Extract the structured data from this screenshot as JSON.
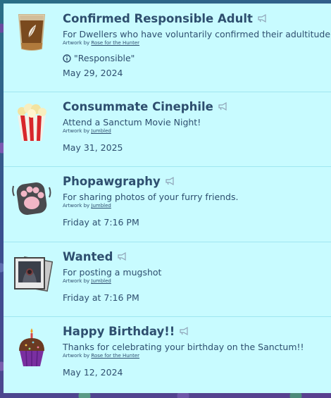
{
  "achievements": [
    {
      "title": "Confirmed Responsible Adult",
      "description": "For Dwellers who have voluntarily confirmed their adultitude",
      "artwork_prefix": "Artwork by",
      "artist": "Rose for the Hunter",
      "note": "\"Responsible\"",
      "date": "May 29, 2024",
      "icon": "drink-glass-icon"
    },
    {
      "title": "Consummate Cinephile",
      "description": "Attend a Sanctum Movie Night!",
      "artwork_prefix": "Artwork by",
      "artist": "Jumbled",
      "date": "May 31, 2025",
      "icon": "popcorn-icon"
    },
    {
      "title": "Phopawgraphy",
      "description": "For sharing photos of your furry friends.",
      "artwork_prefix": "Artwork by",
      "artist": "Jumbled",
      "date": "Friday at 7:16 PM",
      "icon": "paw-icon"
    },
    {
      "title": "Wanted",
      "description": "For posting a mugshot",
      "artwork_prefix": "Artwork by",
      "artist": "Jumbled",
      "date": "Friday at 7:16 PM",
      "icon": "mugshot-photo-icon"
    },
    {
      "title": "Happy Birthday!!",
      "description": "Thanks for celebrating your birthday on the Sanctum!!",
      "artwork_prefix": "Artwork by",
      "artist": "Rose for the Hunter",
      "date": "May 12, 2024",
      "icon": "birthday-cupcake-icon"
    }
  ],
  "colors": {
    "panel": "#c8fbff",
    "text": "#2e4f6f",
    "divider": "#9fe6f0"
  }
}
